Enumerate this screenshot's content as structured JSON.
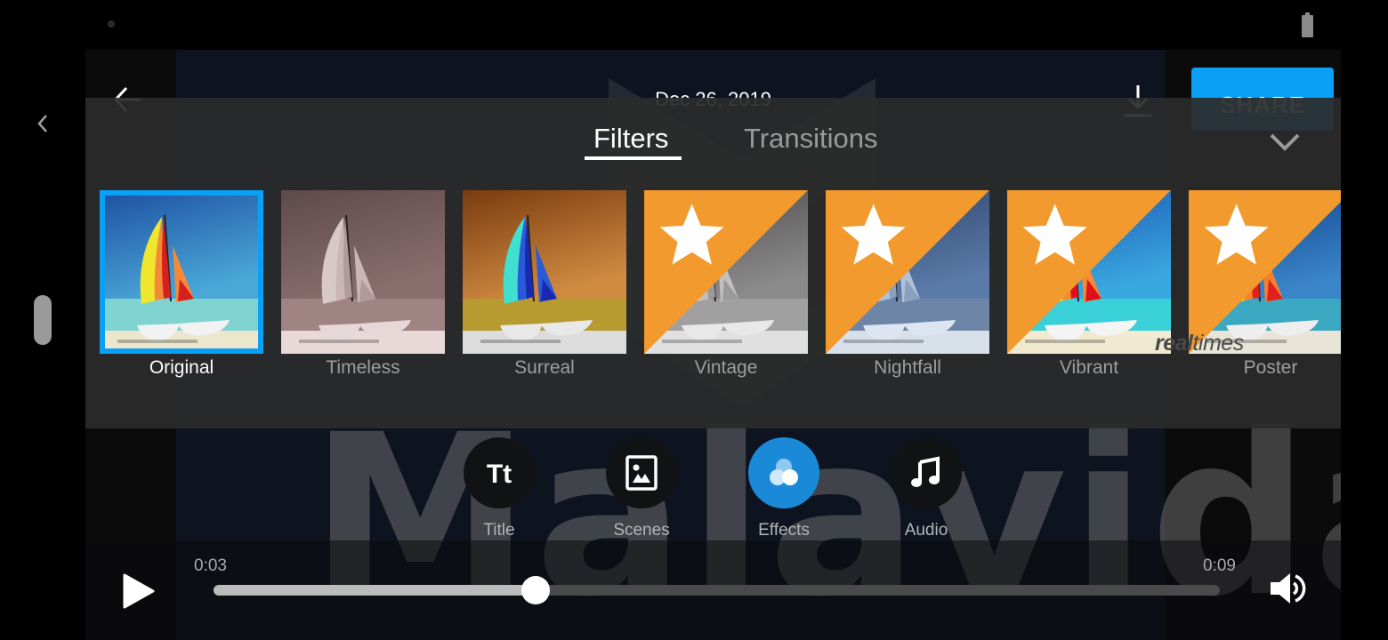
{
  "header": {
    "date": "Dec 26, 2019",
    "share_label": "SHARE"
  },
  "panel": {
    "tabs": [
      {
        "label": "Filters",
        "active": true
      },
      {
        "label": "Transitions",
        "active": false
      }
    ],
    "filters": [
      {
        "label": "Original",
        "selected": true,
        "premium": false,
        "style": "original"
      },
      {
        "label": "Timeless",
        "selected": false,
        "premium": false,
        "style": "timeless"
      },
      {
        "label": "Surreal",
        "selected": false,
        "premium": false,
        "style": "surreal"
      },
      {
        "label": "Vintage",
        "selected": false,
        "premium": true,
        "style": "vintage"
      },
      {
        "label": "Nightfall",
        "selected": false,
        "premium": true,
        "style": "nightfall"
      },
      {
        "label": "Vibrant",
        "selected": false,
        "premium": true,
        "style": "vibrant"
      },
      {
        "label": "Poster",
        "selected": false,
        "premium": true,
        "style": "poster"
      }
    ],
    "watermark_brand": {
      "bold": "real",
      "light": "times"
    }
  },
  "tools": [
    {
      "label": "Title",
      "icon": "title-text-icon",
      "active": false
    },
    {
      "label": "Scenes",
      "icon": "image-icon",
      "active": false
    },
    {
      "label": "Effects",
      "icon": "effects-circles-icon",
      "active": true
    },
    {
      "label": "Audio",
      "icon": "music-note-icon",
      "active": false
    }
  ],
  "player": {
    "current_time": "0:03",
    "total_time": "0:09",
    "progress_fraction": 0.32
  },
  "video_watermark": "Malavida",
  "colors": {
    "accent": "#0aa0f5",
    "premium_badge": "#f29a2e",
    "active_tool": "#1a8ad8"
  }
}
